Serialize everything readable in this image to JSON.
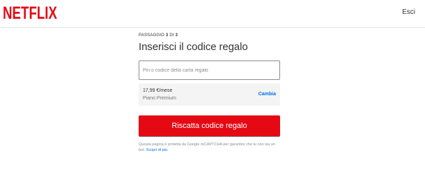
{
  "header": {
    "logo_text": "NETFLIX",
    "signout_label": "Esci"
  },
  "step": {
    "prefix": "PASSAGGIO ",
    "current": "3",
    "of": " DI ",
    "total": "3"
  },
  "title": "Inserisci il codice regalo",
  "gift_input": {
    "placeholder": "Pin o codice della carta regalo",
    "value": ""
  },
  "plan": {
    "price": "17,99 €/mese",
    "name": "Piano Premium",
    "change_label": "Cambia"
  },
  "redeem_button": "Riscatta codice regalo",
  "recaptcha": {
    "text": "Questa pagina è protetta da Google reCAPTCHA per garantire che tu non sia un bot. ",
    "link": "Scopri di più."
  },
  "colors": {
    "brand_red": "#e50914",
    "link_blue": "#0071eb"
  }
}
